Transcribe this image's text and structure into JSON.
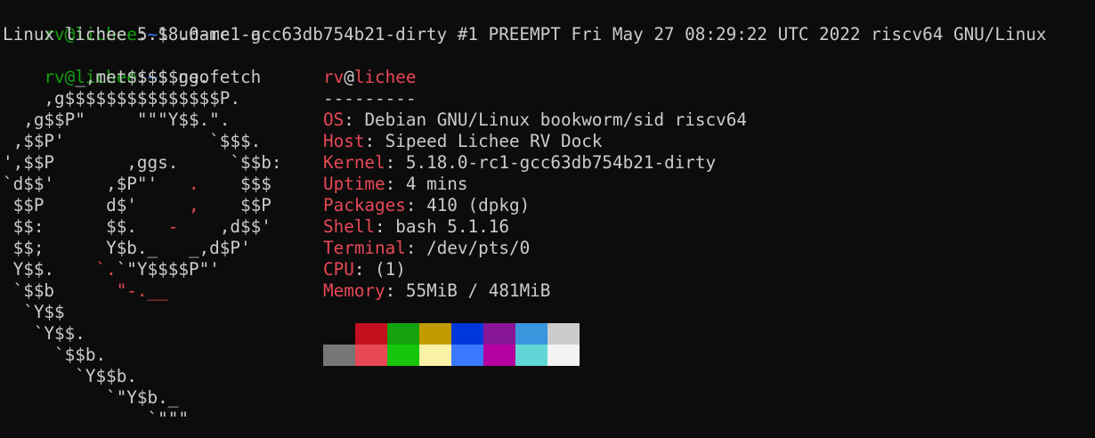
{
  "prompt": {
    "user": "rv",
    "at": "@",
    "host": "lichee",
    "colon": ":",
    "path": "~",
    "dollar": "$"
  },
  "commands": [
    {
      "text": " uname -a"
    },
    {
      "text": " neofetch"
    }
  ],
  "uname_output": "Linux lichee 5.18.0-rc1-gcc63db754b21-dirty #1 PREEMPT Fri May 27 08:29:22 UTC 2022 riscv64 GNU/Linux",
  "logo": {
    "rows": [
      [
        {
          "t": "       _,met$$$$$gg.",
          "c": "white"
        }
      ],
      [
        {
          "t": "    ,g$$$$$$$$$$$$$$$P.",
          "c": "white"
        }
      ],
      [
        {
          "t": "  ,g$$P\"     \"\"\"Y$$.\".",
          "c": "white"
        }
      ],
      [
        {
          "t": " ,$$P'              `$$$.",
          "c": "white"
        }
      ],
      [
        {
          "t": "',$$P       ,ggs.     `$$b:",
          "c": "white"
        }
      ],
      [
        {
          "t": "`d$$'     ,$P\"'   ",
          "c": "white"
        },
        {
          "t": ".",
          "c": "red"
        },
        {
          "t": "    $$$",
          "c": "white"
        }
      ],
      [
        {
          "t": " $$P      d$'     ",
          "c": "white"
        },
        {
          "t": ",",
          "c": "red"
        },
        {
          "t": "    $$P",
          "c": "white"
        }
      ],
      [
        {
          "t": " $$:      $$.   ",
          "c": "white"
        },
        {
          "t": "-",
          "c": "red"
        },
        {
          "t": "    ,d$$'",
          "c": "white"
        }
      ],
      [
        {
          "t": " $$;      Y$b._   _,d$P'",
          "c": "white"
        }
      ],
      [
        {
          "t": " Y$$.    ",
          "c": "white"
        },
        {
          "t": "`.",
          "c": "red"
        },
        {
          "t": "`\"Y$$$$P\"'",
          "c": "white"
        }
      ],
      [
        {
          "t": " `$$b      ",
          "c": "white"
        },
        {
          "t": "\"-.__",
          "c": "red"
        }
      ],
      [
        {
          "t": "  `Y$$",
          "c": "white"
        }
      ],
      [
        {
          "t": "   `Y$$.",
          "c": "white"
        }
      ],
      [
        {
          "t": "     `$$b.",
          "c": "white"
        }
      ],
      [
        {
          "t": "       `Y$$b.",
          "c": "white"
        }
      ],
      [
        {
          "t": "          `\"Y$b._",
          "c": "white"
        }
      ],
      [
        {
          "t": "              `\"\"\"",
          "c": "white"
        }
      ]
    ]
  },
  "info": {
    "title_user": "rv",
    "title_at": "@",
    "title_host": "lichee",
    "underline": "---------",
    "fields": [
      {
        "key": "OS",
        "value": "Debian GNU/Linux bookworm/sid riscv64"
      },
      {
        "key": "Host",
        "value": "Sipeed Lichee RV Dock"
      },
      {
        "key": "Kernel",
        "value": "5.18.0-rc1-gcc63db754b21-dirty"
      },
      {
        "key": "Uptime",
        "value": "4 mins"
      },
      {
        "key": "Packages",
        "value": "410 (dpkg)"
      },
      {
        "key": "Shell",
        "value": "bash 5.1.16"
      },
      {
        "key": "Terminal",
        "value": "/dev/pts/0"
      },
      {
        "key": "CPU",
        "value": "(1)"
      },
      {
        "key": "Memory",
        "value": "55MiB / 481MiB"
      }
    ],
    "separator": ": "
  },
  "palette": {
    "row1": [
      "#0c0c0c",
      "#c50f1f",
      "#13a10e",
      "#c19c00",
      "#0037da",
      "#881798",
      "#3a96dd",
      "#cccccc"
    ],
    "row2": [
      "#767676",
      "#e74856",
      "#16c60c",
      "#f9f1a5",
      "#3b78ff",
      "#b4009e",
      "#61d6d6",
      "#f2f2f2"
    ]
  },
  "colors": {
    "background": "#0c0c0c",
    "foreground": "#cccccc",
    "prompt_green": "#13a10e",
    "path_blue": "#3b78ff",
    "accent_red": "#e74856"
  }
}
